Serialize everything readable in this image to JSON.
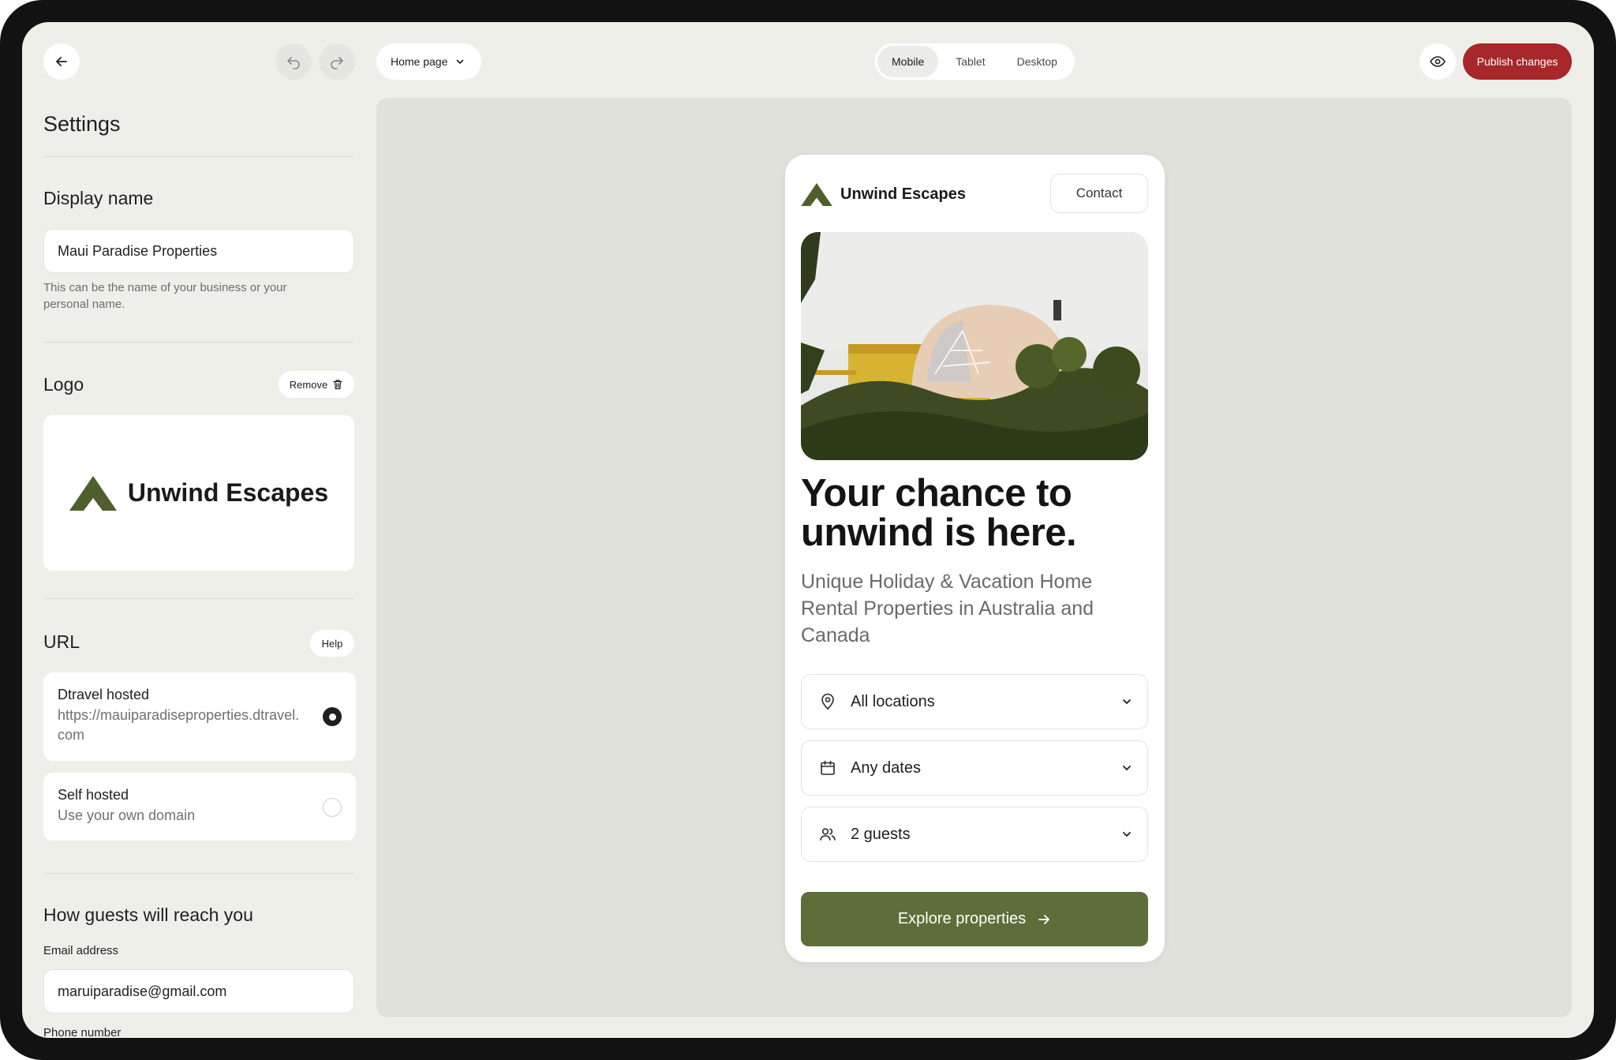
{
  "topbar": {
    "page_select": "Home page",
    "views": [
      "Mobile",
      "Tablet",
      "Desktop"
    ],
    "active_view": "Mobile",
    "publish_label": "Publish changes"
  },
  "settings": {
    "title": "Settings",
    "display_name": {
      "heading": "Display name",
      "value": "Maui Paradise Properties",
      "help_line1": "This can be the name of your business or your",
      "help_line2": "personal name."
    },
    "logo": {
      "heading": "Logo",
      "remove_label": "Remove",
      "brand_text": "Unwind Escapes"
    },
    "url": {
      "heading": "URL",
      "help_label": "Help",
      "options": [
        {
          "title": "Dtravel hosted",
          "desc_line1": "https://mauiparadiseproperties.dtravel.",
          "desc_line2": "com",
          "selected": true
        },
        {
          "title": "Self hosted",
          "desc_line1": "Use your own domain",
          "selected": false
        }
      ]
    },
    "reach": {
      "heading": "How guests will reach you",
      "email_label": "Email address",
      "email_value": "maruiparadise@gmail.com",
      "phone_label": "Phone number"
    }
  },
  "preview": {
    "brand": "Unwind Escapes",
    "contact_label": "Contact",
    "headline_line1": "Your chance to",
    "headline_line2": "unwind is here.",
    "subtitle": "Unique Holiday & Vacation Home Rental Properties in Australia and Canada",
    "filters": [
      {
        "icon": "map-pin-icon",
        "label": "All locations"
      },
      {
        "icon": "calendar-icon",
        "label": "Any dates"
      },
      {
        "icon": "users-icon",
        "label": "2 guests"
      }
    ],
    "cta_label": "Explore properties"
  },
  "colors": {
    "accent": "#5e6e3a",
    "publish": "#a8272b",
    "background": "#efefea"
  }
}
